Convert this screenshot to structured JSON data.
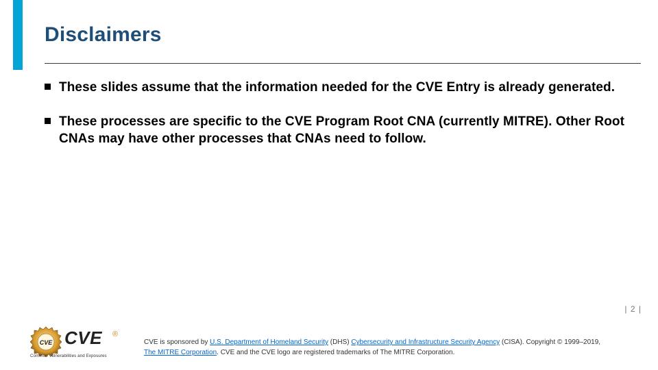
{
  "title": "Disclaimers",
  "bullets": [
    "These slides assume that the information needed for the CVE Entry is already generated.",
    "These processes are specific to the CVE Program Root CNA (currently MITRE).  Other Root CNAs may have other processes that CNAs need to follow."
  ],
  "page_label": "| 2 |",
  "logo": {
    "text": "CVE",
    "registered": "®",
    "subtitle": "Common Vulnerabilities and Exposures"
  },
  "footer": {
    "pre": "CVE is sponsored by ",
    "link1": "U.S. Department of Homeland Security",
    "mid1": " (DHS) ",
    "link2": "Cybersecurity and Infrastructure Security Agency",
    "mid2": " (CISA). Copyright © 1999–2019, ",
    "link3": "The MITRE Corporation",
    "tail": ". CVE and the CVE logo are registered trademarks of The MITRE Corporation."
  }
}
